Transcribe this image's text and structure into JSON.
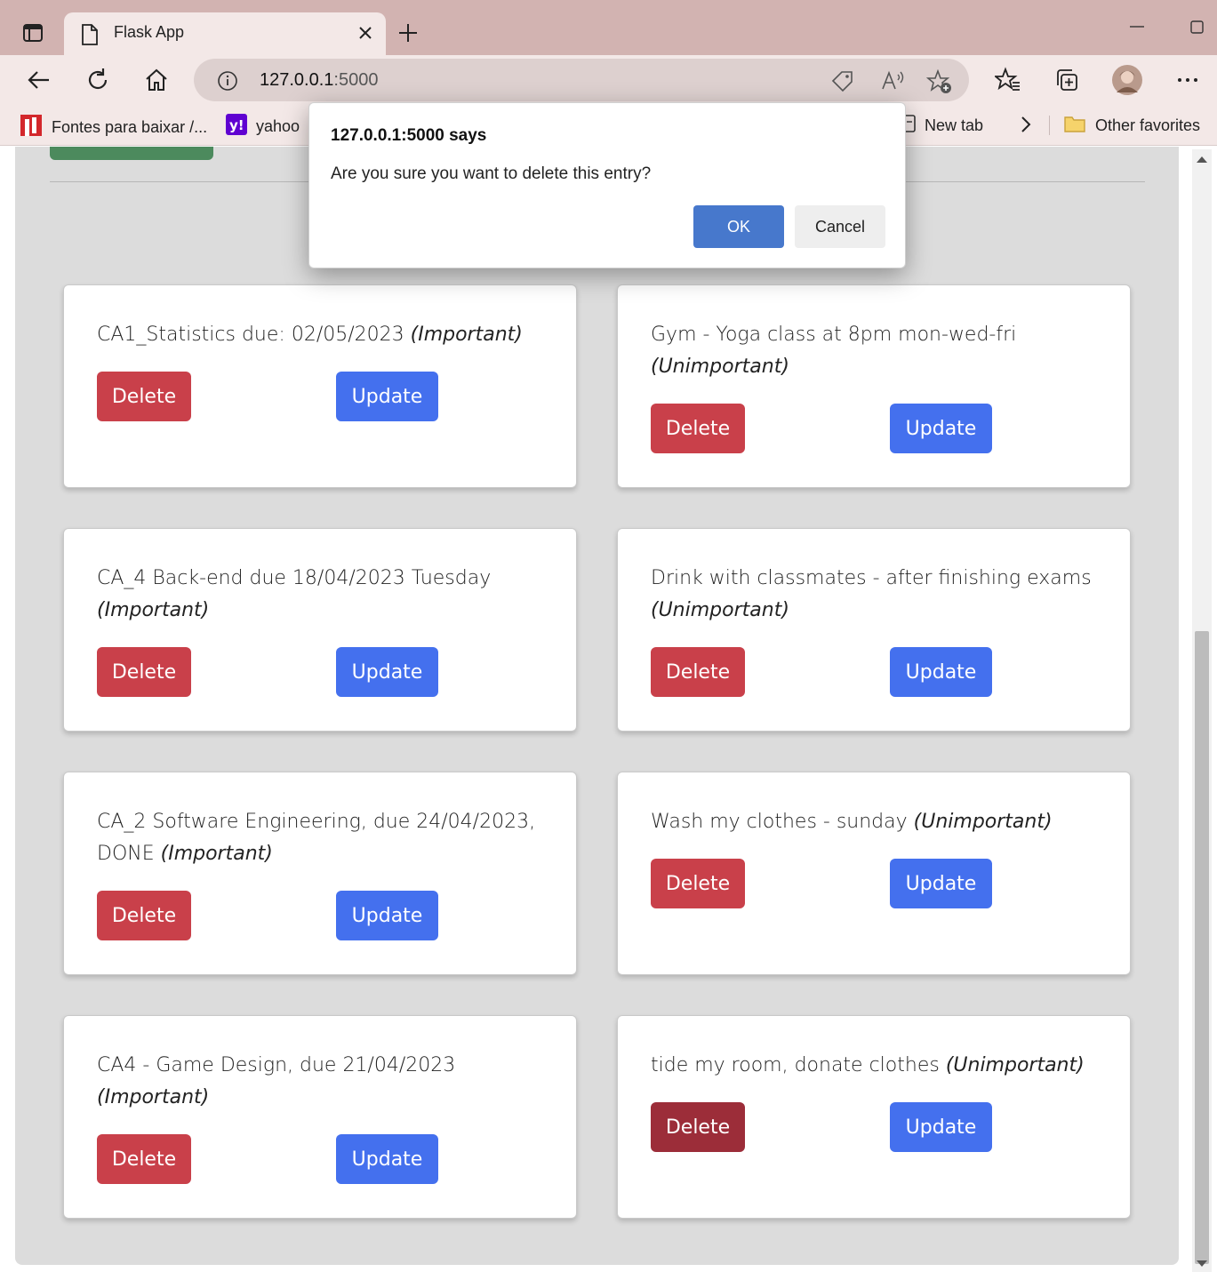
{
  "browser": {
    "tab_title": "Flask App",
    "url_host": "127.0.0.1",
    "url_port": ":5000",
    "bookmarks": [
      {
        "label": "Fontes para baixar /..."
      },
      {
        "label": "yahoo"
      },
      {
        "label": "New tab"
      },
      {
        "label": "Other favorites"
      }
    ],
    "icons": [
      "sidebar-toggle-icon",
      "page-icon",
      "close-icon",
      "plus-icon",
      "minimize-icon",
      "maximize-icon",
      "back-icon",
      "refresh-icon",
      "home-icon",
      "info-icon",
      "tag-icon",
      "read-aloud-icon",
      "add-favorite-icon",
      "favorites-icon",
      "collections-icon",
      "profile-avatar",
      "more-icon",
      "chevron-right-icon",
      "folder-icon"
    ]
  },
  "dialog": {
    "title": "127.0.0.1:5000 says",
    "message": "Are you sure you want to delete this entry?",
    "ok_label": "OK",
    "cancel_label": "Cancel"
  },
  "tasks": [
    {
      "text": "CA1_Statistics due: 02/05/2023",
      "tag": "(Important)",
      "delete_label": "Delete",
      "update_label": "Update"
    },
    {
      "text": "Gym - Yoga class at 8pm mon-wed-fri",
      "tag": "(Unimportant)",
      "delete_label": "Delete",
      "update_label": "Update"
    },
    {
      "text": "CA_4 Back-end due 18/04/2023 Tuesday",
      "tag": "(Important)",
      "delete_label": "Delete",
      "update_label": "Update"
    },
    {
      "text": "Drink with classmates - after finishing exams",
      "tag": "(Unimportant)",
      "delete_label": "Delete",
      "update_label": "Update"
    },
    {
      "text": "CA_2 Software Engineering, due 24/04/2023, DONE",
      "tag": "(Important)",
      "delete_label": "Delete",
      "update_label": "Update"
    },
    {
      "text": "Wash my clothes - sunday",
      "tag": "(Unimportant)",
      "delete_label": "Delete",
      "update_label": "Update"
    },
    {
      "text": "CA4 - Game Design, due 21/04/2023",
      "tag": "(Important)",
      "delete_label": "Delete",
      "update_label": "Update"
    },
    {
      "text": "tide my room, donate clothes",
      "tag": "(Unimportant)",
      "delete_label": "Delete",
      "update_label": "Update"
    }
  ],
  "colors": {
    "delete": "#c9404a",
    "delete_active": "#9c2d39",
    "update": "#4470ee",
    "dialog_ok": "#4778cc"
  }
}
